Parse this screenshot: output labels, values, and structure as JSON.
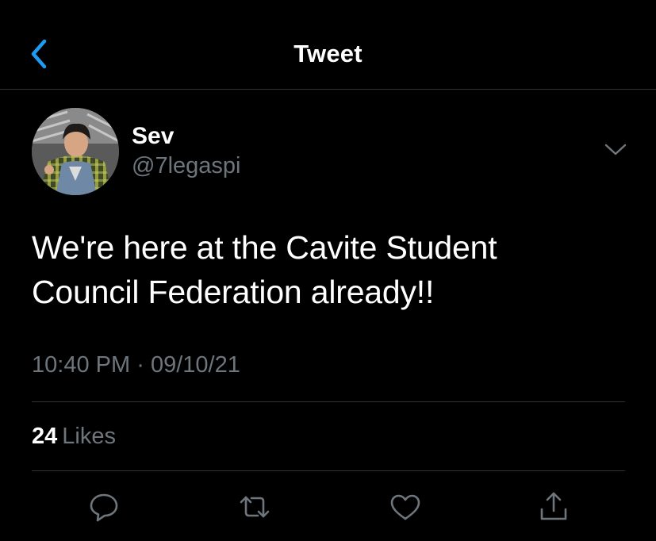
{
  "header": {
    "title": "Tweet",
    "back_icon": "chevron-left-icon",
    "accent_color": "#1d9bf0"
  },
  "tweet": {
    "author": {
      "display_name": "Sev",
      "handle": "@7legaspi"
    },
    "text_lines": [
      "We're here at the Cavite Student",
      "Council Federation already!!"
    ],
    "time": "10:40 PM",
    "separator": "·",
    "date": "09/10/21",
    "likes_count": "24",
    "likes_label": "Likes"
  },
  "actions": [
    {
      "name": "reply",
      "icon": "comment-icon"
    },
    {
      "name": "retweet",
      "icon": "retweet-icon"
    },
    {
      "name": "like",
      "icon": "heart-icon"
    },
    {
      "name": "share",
      "icon": "share-icon"
    }
  ],
  "colors": {
    "background": "#000000",
    "text": "#ffffff",
    "secondary_text": "#6e767d",
    "divider": "#2f3336"
  }
}
